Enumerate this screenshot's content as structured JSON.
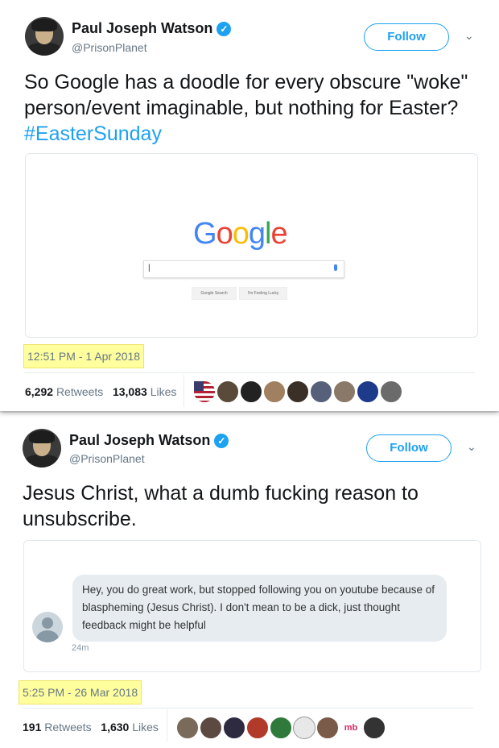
{
  "tweets": [
    {
      "author_name": "Paul Joseph Watson",
      "verified_icon": "verified-badge-icon",
      "handle": "@PrisonPlanet",
      "follow_label": "Follow",
      "text": "So Google has a doodle for every obscure \"woke\" person/event imaginable, but nothing for Easter? ",
      "hashtag": "#EasterSunday",
      "media": {
        "logo_text": "Google",
        "search_value": "|",
        "buttons": [
          "Google Search",
          "I'm Feeling Lucky"
        ]
      },
      "timestamp": "12:51 PM - 1 Apr 2018",
      "retweets_count": "6,292",
      "retweets_label": "Retweets",
      "likes_count": "13,083",
      "likes_label": "Likes"
    },
    {
      "author_name": "Paul Joseph Watson",
      "verified_icon": "verified-badge-icon",
      "handle": "@PrisonPlanet",
      "follow_label": "Follow",
      "text": "Jesus Christ, what a dumb fucking reason to unsubscribe.",
      "media": {
        "message": "Hey, you do great work, but stopped following you on youtube because of blaspheming (Jesus Christ). I don't mean to be a dick, just thought feedback might be helpful",
        "message_time": "24m"
      },
      "timestamp": "5:25 PM - 26 Mar 2018",
      "retweets_count": "191",
      "retweets_label": "Retweets",
      "likes_count": "1,630",
      "likes_label": "Likes"
    }
  ],
  "colors": {
    "link": "#1da1f2",
    "highlight": "#ffff9e",
    "secondary_text": "#657786"
  }
}
